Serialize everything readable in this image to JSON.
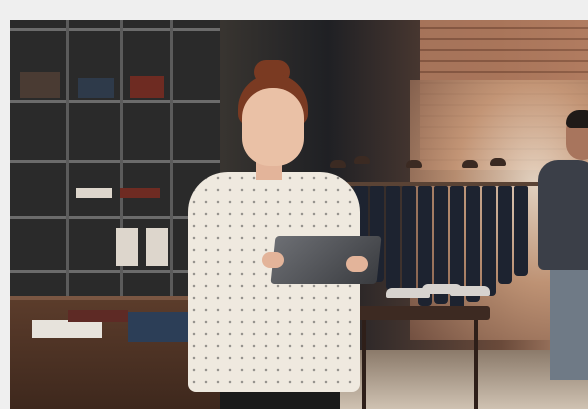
{
  "scene": {
    "subjects": {
      "woman": {
        "icon": "woman-figure"
      },
      "man": {
        "icon": "man-figure"
      },
      "tablet": {
        "icon": "tablet"
      }
    },
    "colors": {
      "frame": "#efefef",
      "shirt": "#efe9df",
      "hair": "#7a3a22",
      "tablet": "#5a5c61",
      "denim": "#1d2330"
    }
  }
}
